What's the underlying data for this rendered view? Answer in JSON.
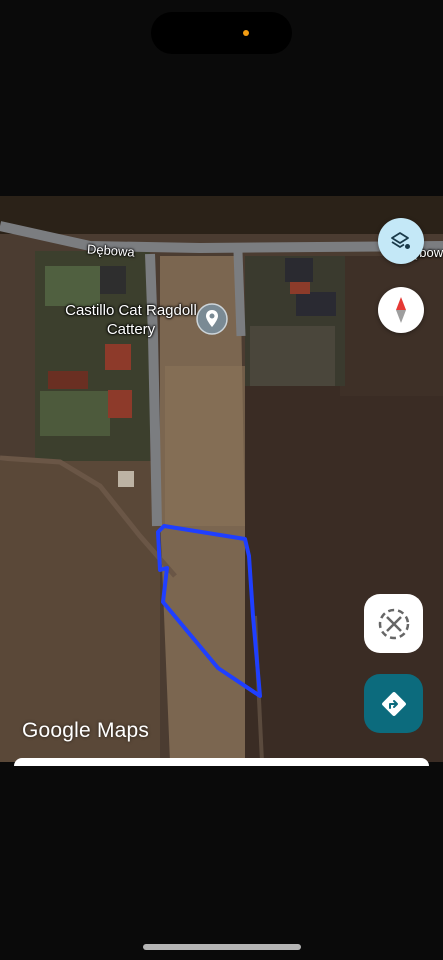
{
  "map": {
    "street_label": "Dębowa",
    "street_label_right": "ębow",
    "poi": {
      "name": "Castillo Cat Ragdoll Cattery",
      "icon": "location-pin-icon"
    },
    "boundary_color": "#1f3fff",
    "logo_bold": "Google",
    "logo_light": "Maps"
  },
  "controls": {
    "layers_icon": "layers-icon",
    "compass_icon": "compass-icon",
    "recenter_icon": "recenter-icon",
    "directions_icon": "directions-icon",
    "layers_bg": "#c4e8f7",
    "directions_bg": "#0c6b7d"
  },
  "status": {
    "camera_indicator_color": "#f39c12"
  }
}
